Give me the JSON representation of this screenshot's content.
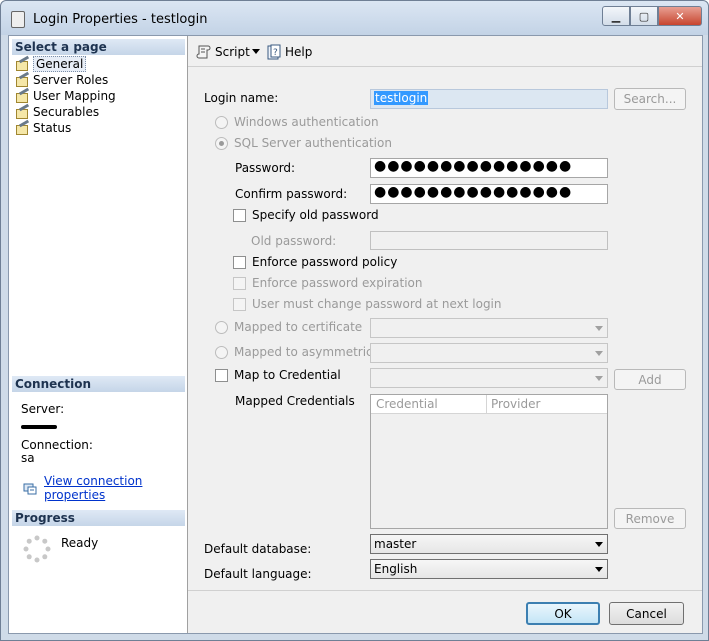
{
  "window": {
    "title": "Login Properties - testlogin",
    "min_glyph": "▁",
    "max_glyph": "▢",
    "close_glyph": "✕"
  },
  "left": {
    "select_page_header": "Select a page",
    "pages": [
      {
        "label": "General",
        "selected": true
      },
      {
        "label": "Server Roles",
        "selected": false
      },
      {
        "label": "User Mapping",
        "selected": false
      },
      {
        "label": "Securables",
        "selected": false
      },
      {
        "label": "Status",
        "selected": false
      }
    ],
    "connection_header": "Connection",
    "server_label": "Server:",
    "connection_label": "Connection:",
    "connection_value": "sa",
    "view_connection_link": "View connection properties",
    "progress_header": "Progress",
    "progress_status": "Ready"
  },
  "toolbar": {
    "script_label": "Script",
    "help_label": "Help"
  },
  "form": {
    "login_name_label": "Login name:",
    "login_name_value": "testlogin",
    "search_button": "Search...",
    "windows_auth_label": "Windows authentication",
    "sql_auth_label": "SQL Server authentication",
    "password_label": "Password:",
    "password_value": "●●●●●●●●●●●●●●●",
    "confirm_password_label": "Confirm password:",
    "confirm_password_value": "●●●●●●●●●●●●●●●",
    "specify_old_password_label": "Specify old password",
    "old_password_label": "Old password:",
    "enforce_policy_label": "Enforce password policy",
    "enforce_expiration_label": "Enforce password expiration",
    "must_change_label": "User must change password at next login",
    "mapped_cert_label": "Mapped to certificate",
    "mapped_asym_label": "Mapped to asymmetric key",
    "map_credential_label": "Map to Credential",
    "add_button": "Add",
    "mapped_credentials_label": "Mapped Credentials",
    "credentials_columns": [
      "Credential",
      "Provider"
    ],
    "remove_button": "Remove",
    "default_database_label": "Default database:",
    "default_database_value": "master",
    "default_language_label": "Default language:",
    "default_language_value": "English"
  },
  "buttons": {
    "ok": "OK",
    "cancel": "Cancel"
  }
}
